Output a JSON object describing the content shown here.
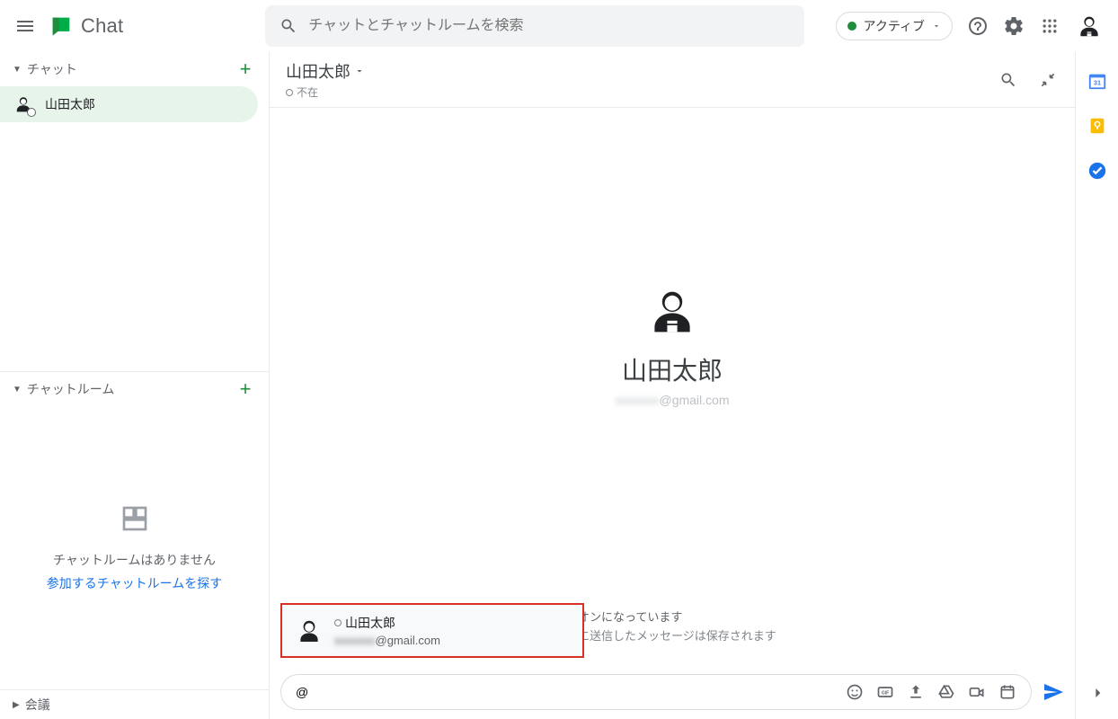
{
  "app": {
    "name": "Chat"
  },
  "search": {
    "placeholder": "チャットとチャットルームを検索"
  },
  "status": {
    "label": "アクティブ"
  },
  "sidebar": {
    "chat": {
      "title": "チャット",
      "items": [
        {
          "name": "山田太郎"
        }
      ]
    },
    "rooms": {
      "title": "チャットルーム",
      "empty": "チャットルームはありません",
      "find_link": "参加するチャットルームを探す"
    },
    "meet": {
      "title": "会議"
    }
  },
  "chat_header": {
    "name": "山田太郎",
    "status": "不在"
  },
  "profile": {
    "name": "山田太郎",
    "email_suffix": "@gmail.com"
  },
  "history": {
    "line1": "履歴がオンになっています",
    "line2": "のときに送信したメッセージは保存されます"
  },
  "mention": {
    "name": "山田太郎",
    "email_suffix": "@gmail.com"
  },
  "compose": {
    "value": "@"
  }
}
